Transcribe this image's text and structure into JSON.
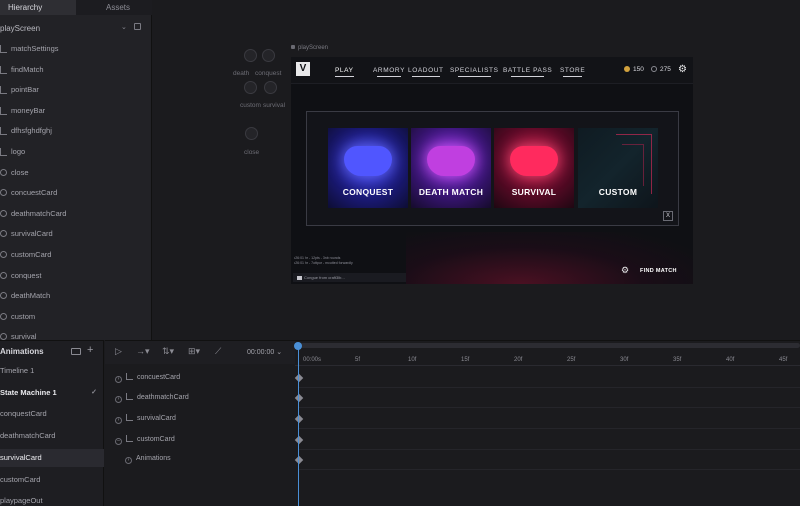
{
  "hierarchy": {
    "tabs": [
      "Hierarchy",
      "Assets"
    ],
    "root": "playScreen",
    "items": [
      {
        "label": "matchSettings",
        "icon": "group-icon"
      },
      {
        "label": "findMatch",
        "icon": "group-icon"
      },
      {
        "label": "pointBar",
        "icon": "group-icon"
      },
      {
        "label": "moneyBar",
        "icon": "group-icon"
      },
      {
        "label": "dfhsfghdfghj",
        "icon": "group-icon"
      },
      {
        "label": "logo",
        "icon": "group-icon"
      },
      {
        "label": "close",
        "icon": "node-icon"
      },
      {
        "label": "concuestCard",
        "icon": "node-icon"
      },
      {
        "label": "deathmatchCard",
        "icon": "node-icon"
      },
      {
        "label": "survivalCard",
        "icon": "node-icon"
      },
      {
        "label": "customCard",
        "icon": "node-icon"
      },
      {
        "label": "conquest",
        "icon": "node-icon"
      },
      {
        "label": "deathMatch",
        "icon": "node-icon"
      },
      {
        "label": "custom",
        "icon": "node-icon"
      },
      {
        "label": "survival",
        "icon": "node-icon"
      }
    ]
  },
  "canvas": {
    "artboard_label": "playScreen",
    "ghosts": {
      "death": "death",
      "conquest": "conquest",
      "custom": "custom",
      "survival": "survival",
      "close": "close"
    }
  },
  "game": {
    "logo": "V",
    "nav": [
      "PLAY",
      "ARMORY",
      "LOADOUT",
      "SPECIALISTS",
      "BATTLE PASS",
      "STORE"
    ],
    "coins": "150",
    "gems": "275",
    "cards": [
      "CONQUEST",
      "DEATH MATCH",
      "SURVIVAL",
      "CUSTOM"
    ],
    "close": "X",
    "chat_lines": [
      "•26:01 hr - 12pts - 3nb rounds",
      "•26:01 hr - 7ottpor - mcutted forwardly"
    ],
    "chat_input": "Congue from craft3lb...",
    "find_match": "FIND MATCH"
  },
  "animations": {
    "title": "Animations",
    "items": [
      "Timeline 1",
      "State Machine 1",
      "conquestCard",
      "deathmatchCard",
      "survivalCard",
      "customCard",
      "playpageOut"
    ],
    "time": "00:00:00",
    "tracks": [
      "concuestCard",
      "deathmatchCard",
      "survivalCard",
      "customCard",
      "Animations"
    ],
    "ticks": [
      "00:00s",
      "5f",
      "10f",
      "15f",
      "20f",
      "25f",
      "30f",
      "35f",
      "40f",
      "45f"
    ]
  },
  "colors": {
    "accent": "#4a8fd6",
    "conquest": "#3b3fe8",
    "deathmatch": "#c03fe0",
    "survival": "#ff2a5e"
  }
}
